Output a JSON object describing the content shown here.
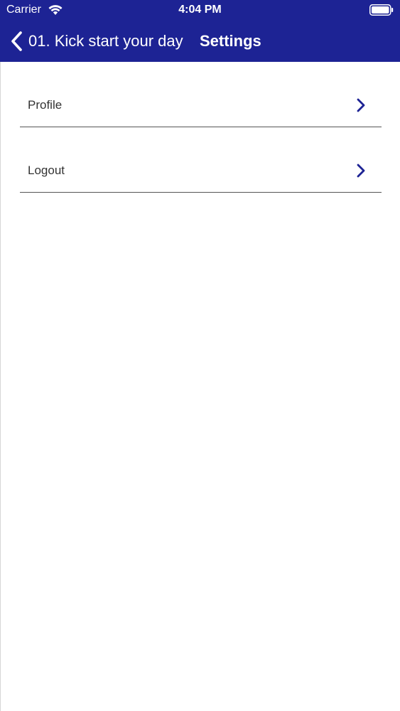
{
  "status_bar": {
    "carrier": "Carrier",
    "time": "4:04 PM",
    "wifi_icon": "wifi-icon",
    "battery_icon": "battery-icon"
  },
  "nav": {
    "back_label": "01. Kick start your day",
    "title": "Settings",
    "back_icon": "chevron-left-icon"
  },
  "settings": {
    "items": [
      {
        "label": "Profile",
        "icon": "chevron-right-icon"
      },
      {
        "label": "Logout",
        "icon": "chevron-right-icon"
      }
    ]
  },
  "colors": {
    "header_bg": "#1d2394",
    "chevron": "#1d2394",
    "divider": "#555555",
    "label_text": "#333333"
  }
}
